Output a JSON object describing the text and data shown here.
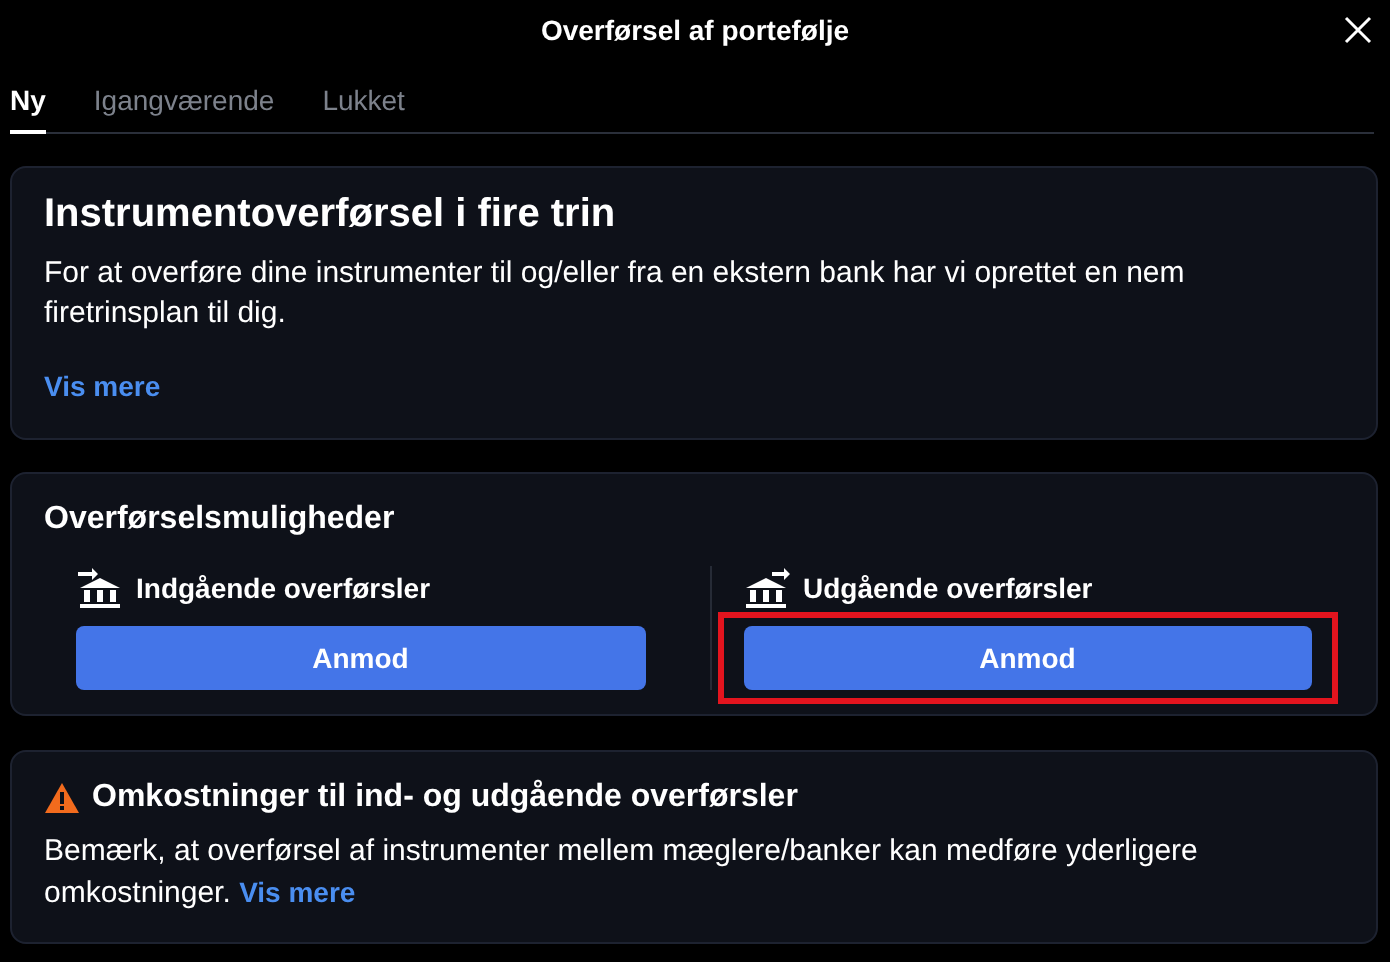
{
  "window": {
    "title": "Overførsel af portefølje"
  },
  "tabs": [
    {
      "label": "Ny",
      "selected": true
    },
    {
      "label": "Igangværende",
      "selected": false
    },
    {
      "label": "Lukket",
      "selected": false
    }
  ],
  "intro": {
    "title": "Instrumentoverførsel i fire trin",
    "text": "For at overføre dine instrumenter til og/eller fra en ekstern bank har vi oprettet en nem firetrinsplan til dig.",
    "link": "Vis mere"
  },
  "options": {
    "title": "Overførselsmuligheder",
    "items": [
      {
        "kind": "incoming",
        "label": "Indgående overførsler",
        "button": "Anmod",
        "highlighted": false
      },
      {
        "kind": "outgoing",
        "label": "Udgående overførsler",
        "button": "Anmod",
        "highlighted": true
      }
    ]
  },
  "warning": {
    "title": "Omkostninger til ind- og udgående overførsler",
    "text": "Bemærk, at overførsel af instrumenter mellem mæglere/banker kan medføre yderligere omkostninger.",
    "link": "Vis mere"
  }
}
